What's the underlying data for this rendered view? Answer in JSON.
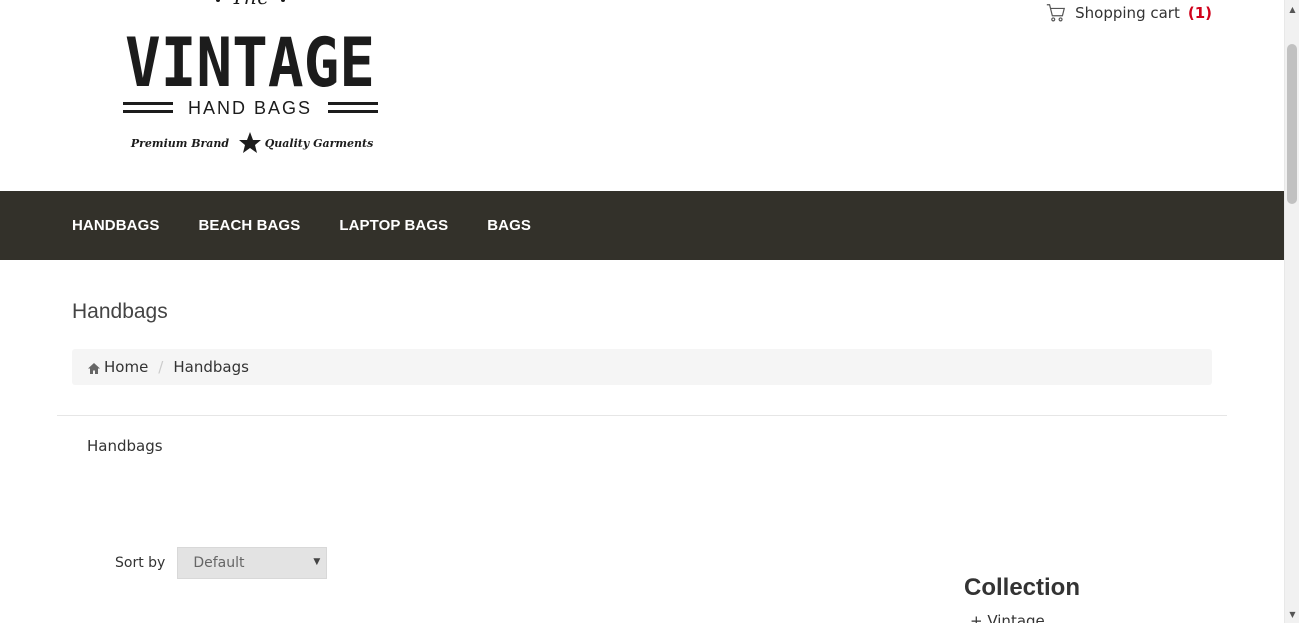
{
  "header": {
    "logo": {
      "top_word": "The",
      "brand": "VINTAGE",
      "sub": "HAND BAGS",
      "tagline_left": "Premium Brand",
      "tagline_right": "Quality Garments"
    },
    "cart": {
      "label": "Shopping cart",
      "count": "(1)",
      "icon": "shopping-cart-icon"
    }
  },
  "nav": {
    "items": [
      {
        "label": "HANDBAGS"
      },
      {
        "label": "BEACH BAGS"
      },
      {
        "label": "LAPTOP BAGS"
      },
      {
        "label": "BAGS"
      }
    ]
  },
  "main": {
    "page_title": "Handbags",
    "breadcrumb": {
      "home": "Home",
      "home_icon": "home-icon",
      "separator": "/",
      "current": "Handbags"
    },
    "category_name": "Handbags",
    "sort": {
      "label": "Sort by",
      "selected": "Default"
    }
  },
  "sidebar": {
    "collection_title": "Collection",
    "collection_item": "+ Vintage"
  },
  "colors": {
    "nav_bg": "#33312a",
    "cart_count": "#d0021b",
    "breadcrumb_bg": "#f5f5f5"
  }
}
